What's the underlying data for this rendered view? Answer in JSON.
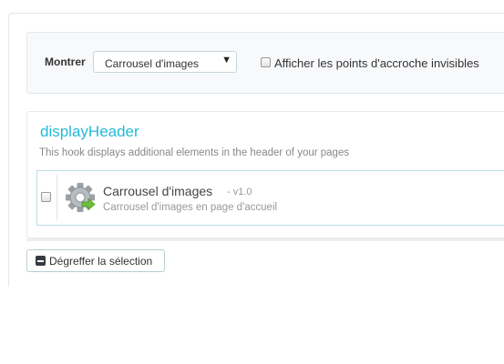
{
  "filter": {
    "label": "Montrer",
    "select_value": "Carrousel d'images",
    "select_arrow": "▼",
    "invisible_hooks_label": "Afficher les points d'accroche invisibles"
  },
  "hook": {
    "title": "displayHeader",
    "description": "This hook displays additional elements in the header of your pages",
    "module": {
      "name": "Carrousel d'images",
      "version": "- v1.0",
      "description": "Carrousel d'images en page d'accueil",
      "icon": "gear-arrow-icon"
    }
  },
  "actions": {
    "unhook_label": "Dégreffer la sélection"
  },
  "colors": {
    "accent": "#25b9d7",
    "arrow_green": "#6cbf3a"
  }
}
